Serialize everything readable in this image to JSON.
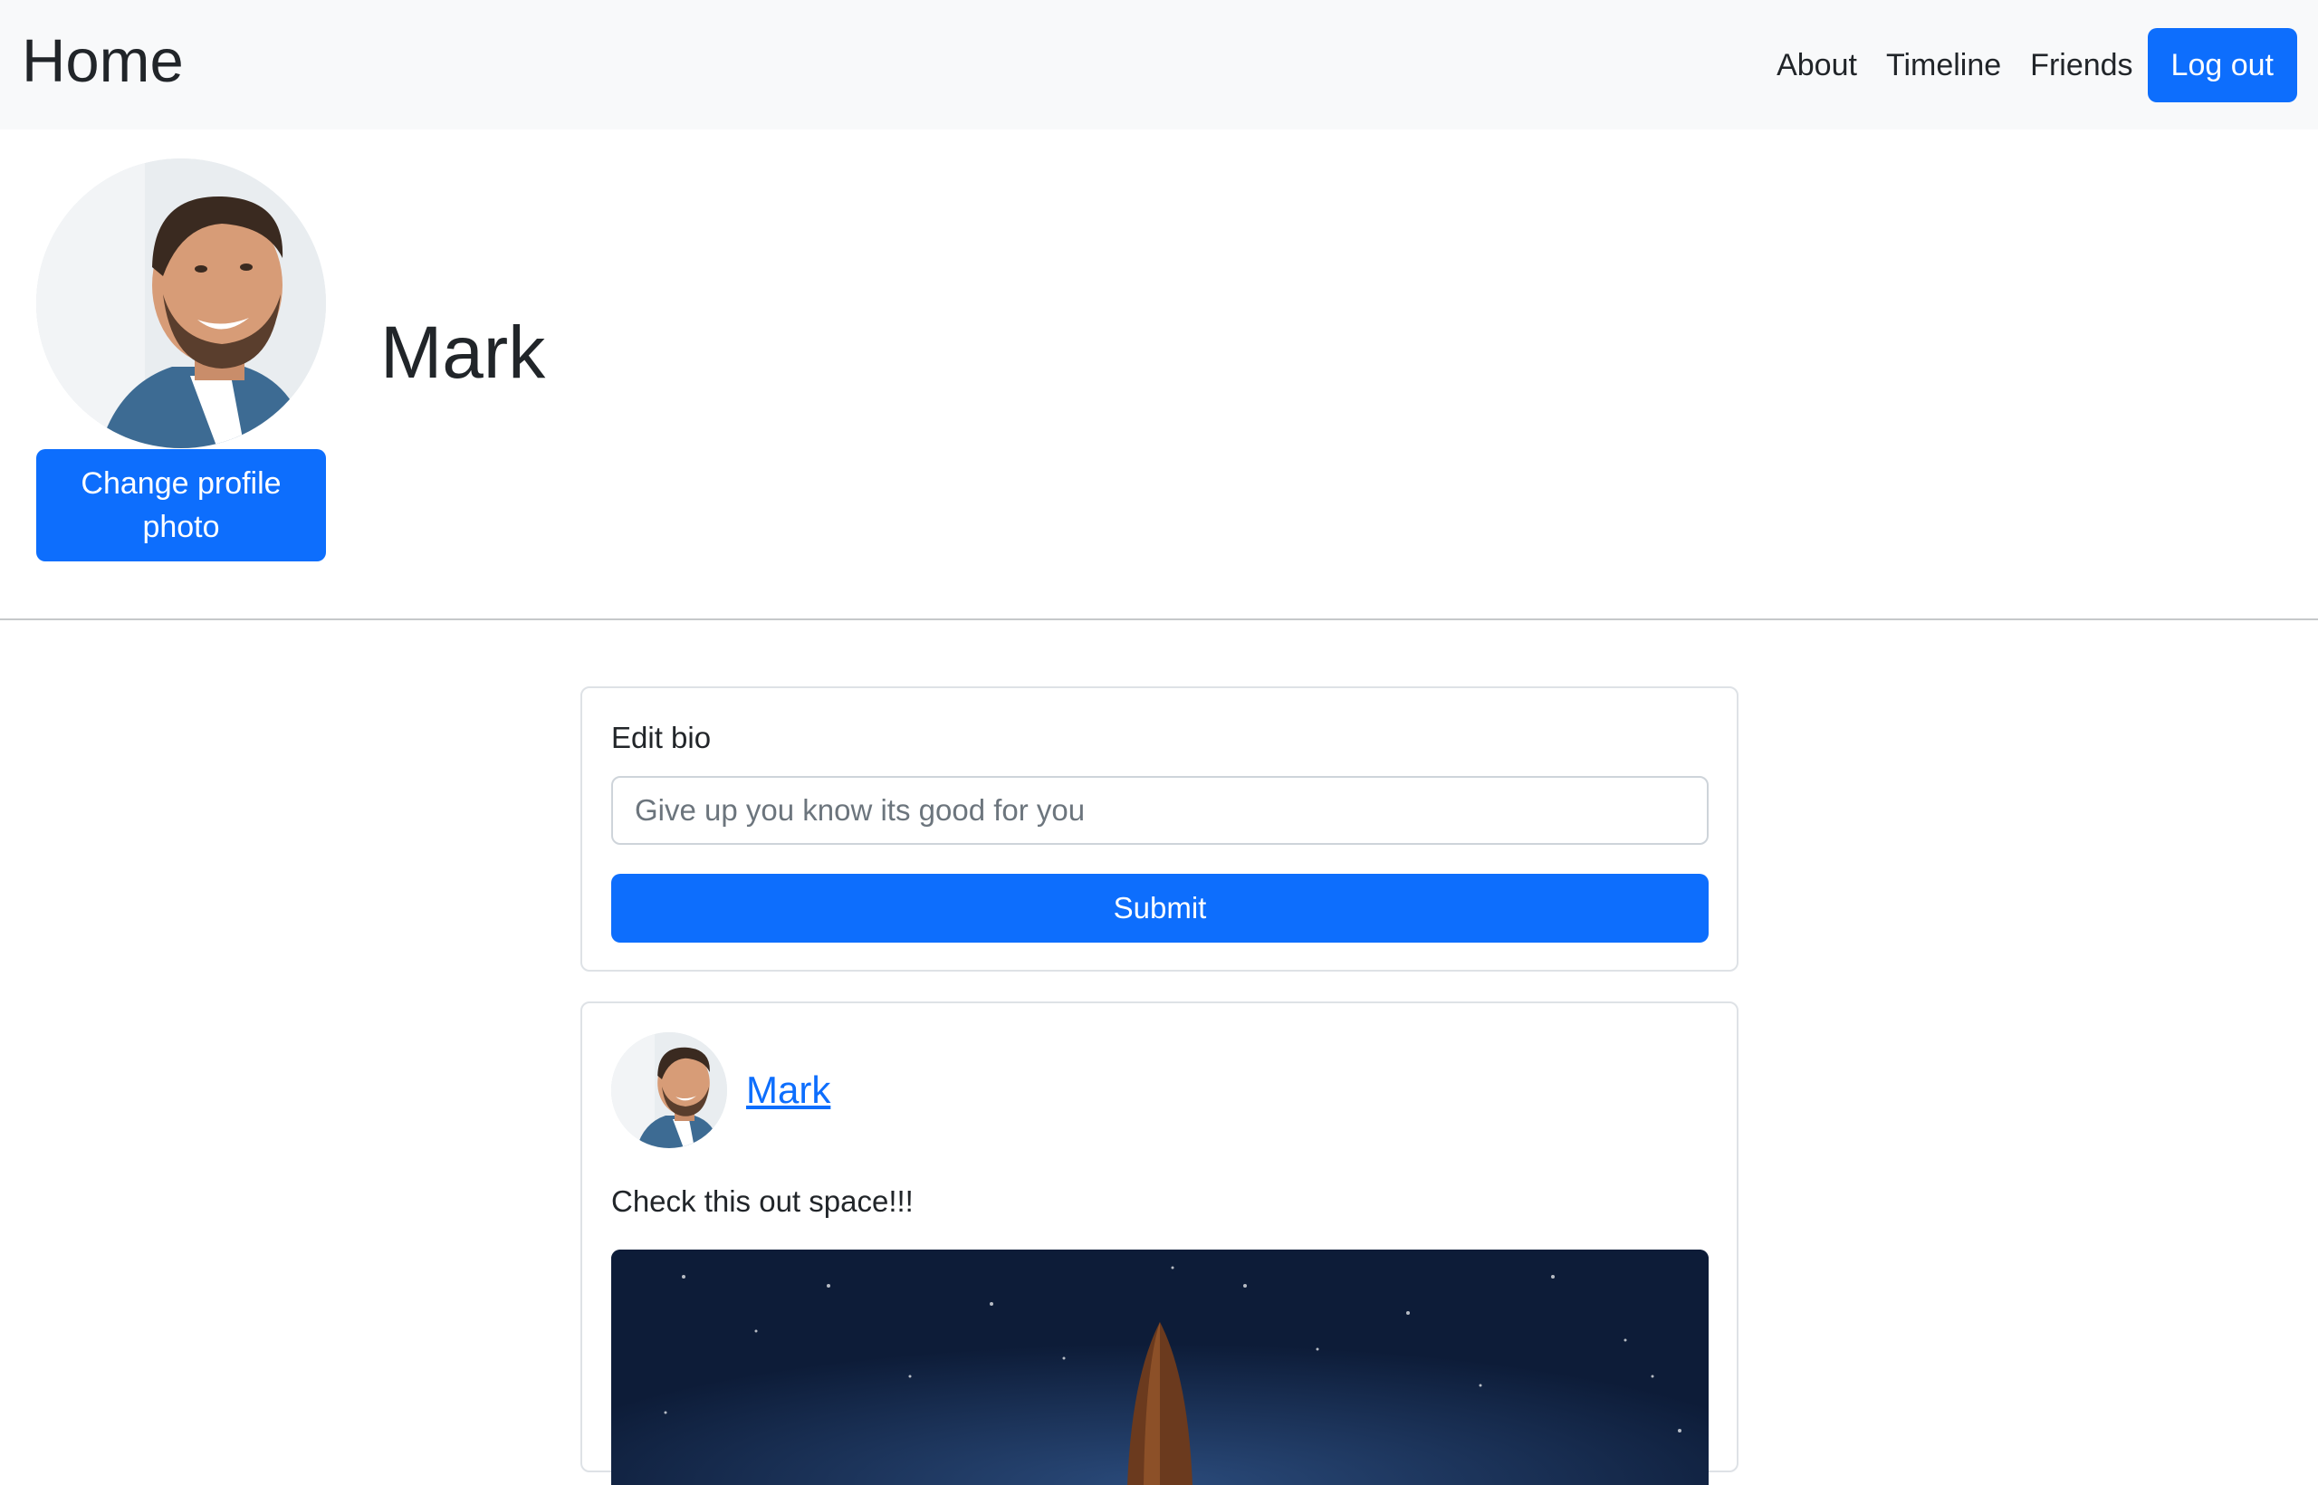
{
  "navbar": {
    "brand": "Home",
    "links": [
      "About",
      "Timeline",
      "Friends"
    ],
    "logout_label": "Log out"
  },
  "profile": {
    "name": "Mark",
    "change_photo_label": "Change profile photo"
  },
  "bio_form": {
    "label": "Edit bio",
    "input_placeholder": "Give up you know its good for you",
    "submit_label": "Submit"
  },
  "post": {
    "author": "Mark",
    "text": "Check this out space!!!"
  },
  "colors": {
    "primary": "#0d6efd",
    "navbar_bg": "#f8f9fa",
    "text": "#212529"
  }
}
